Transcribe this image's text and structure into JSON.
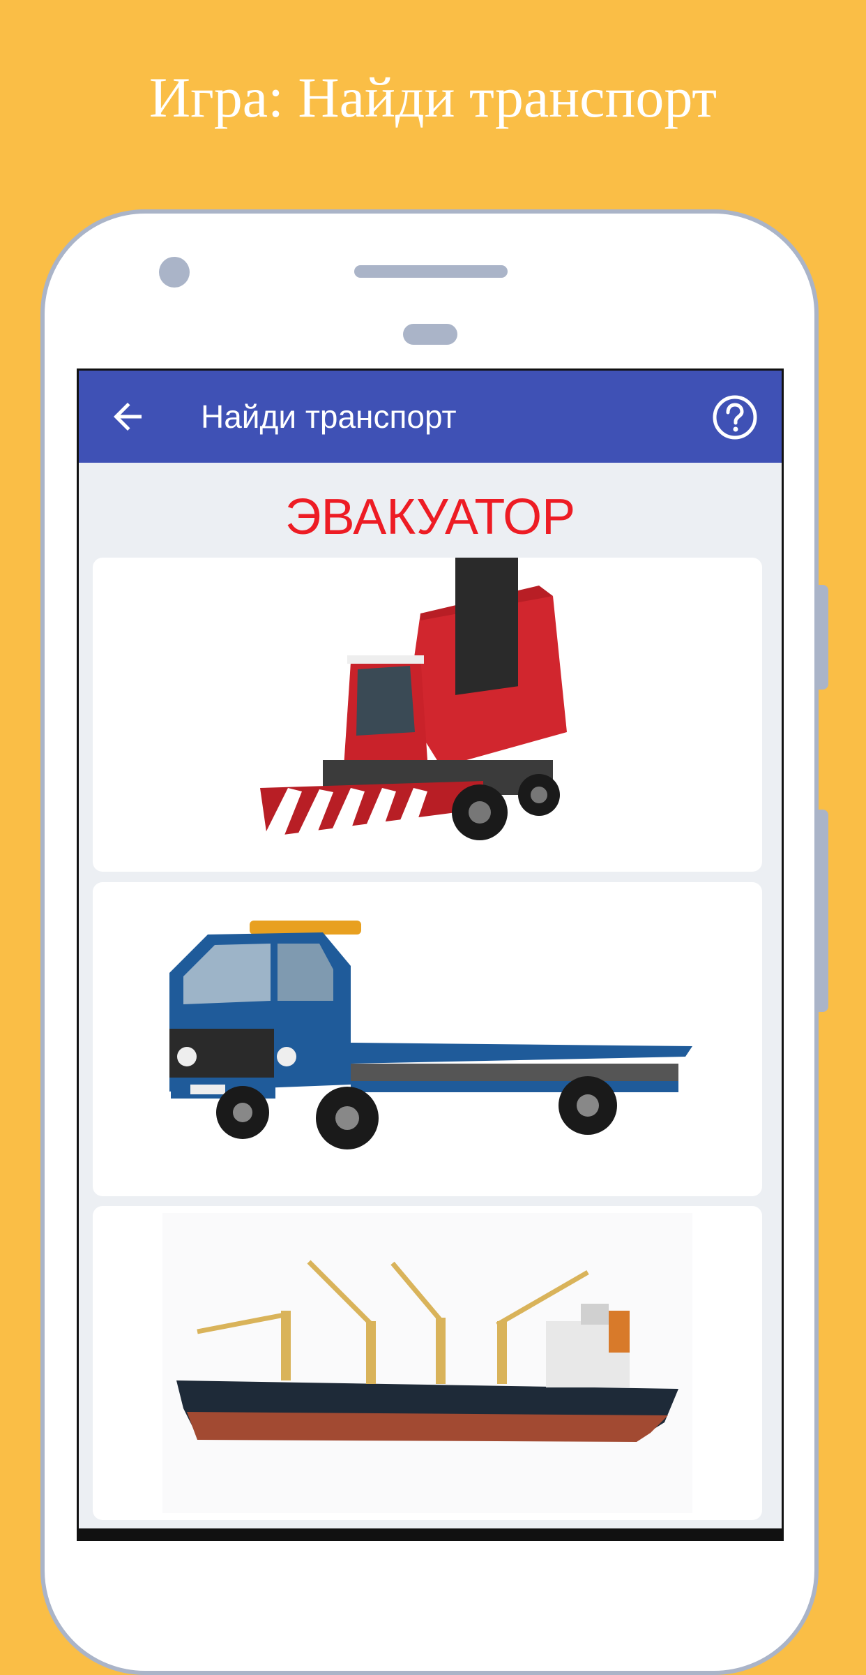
{
  "promo": {
    "title": "Игра: Найди транспорт"
  },
  "appbar": {
    "title": "Найди транспорт",
    "back_icon": "arrow-left-icon",
    "help_icon": "help-circle-icon",
    "color": "#3F51B5"
  },
  "game": {
    "target_word": "ЭВАКУАТОР",
    "target_color": "#ED1C24",
    "options": [
      {
        "name": "cotton-harvester-image"
      },
      {
        "name": "tow-truck-image"
      },
      {
        "name": "cargo-ship-image"
      }
    ]
  },
  "colors": {
    "background": "#FABE46",
    "phone_frame": "#AAB4C8"
  }
}
